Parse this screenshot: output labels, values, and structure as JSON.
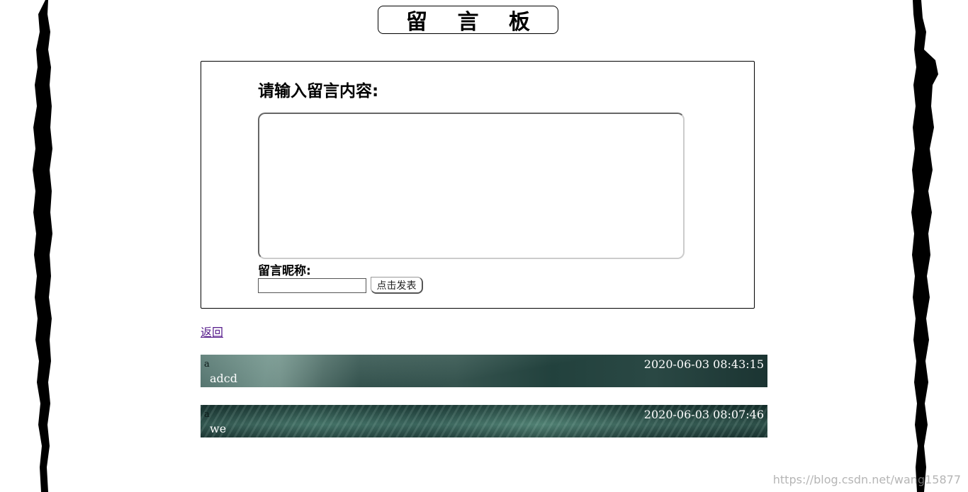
{
  "page": {
    "title": "留 言 板",
    "back_label": "返回",
    "watermark": "https://blog.csdn.net/wang15877"
  },
  "form": {
    "prompt": "请输入留言内容:",
    "content_value": "",
    "nickname_label": "留言昵称:",
    "nickname_value": "",
    "submit_label": "点击发表"
  },
  "messages": [
    {
      "author": "a",
      "time": "2020-06-03 08:43:15",
      "content": "adcd"
    },
    {
      "author": "a",
      "time": "2020-06-03 08:07:46",
      "content": "we"
    }
  ],
  "colors": {
    "link_visited": "#551a8b",
    "message_bg": "#2c4a46"
  },
  "icons": {
    "left_border": "torn-edge-decoration",
    "right_border": "torn-edge-decoration"
  }
}
